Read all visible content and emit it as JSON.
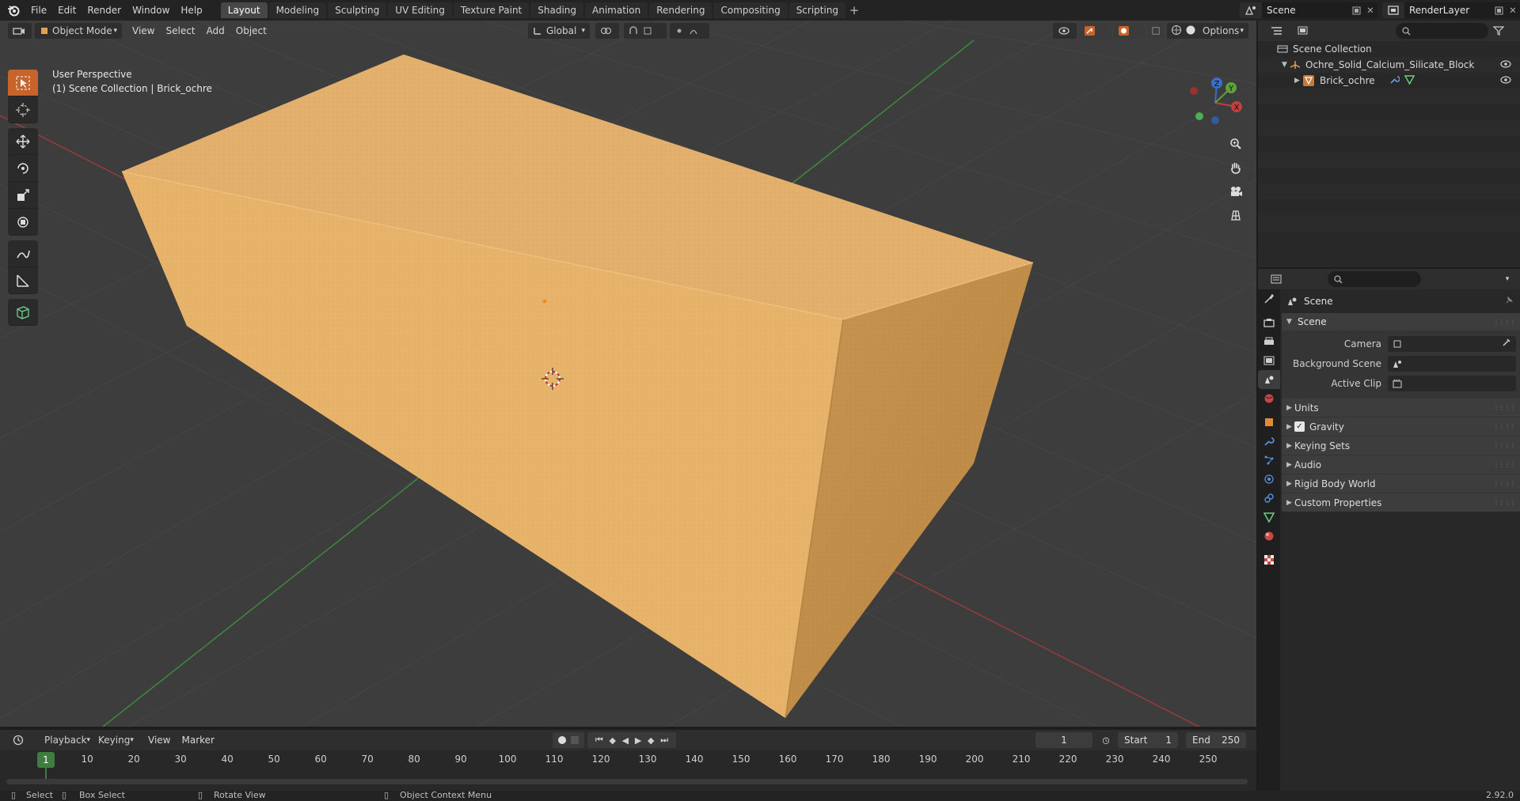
{
  "topbar": {
    "menus": [
      "File",
      "Edit",
      "Render",
      "Window",
      "Help"
    ],
    "workspaces": [
      "Layout",
      "Modeling",
      "Sculpting",
      "UV Editing",
      "Texture Paint",
      "Shading",
      "Animation",
      "Rendering",
      "Compositing",
      "Scripting"
    ],
    "active_workspace": "Layout",
    "scene_name": "Scene",
    "view_layer": "RenderLayer"
  },
  "viewport": {
    "mode": "Object Mode",
    "menus": [
      "View",
      "Select",
      "Add",
      "Object"
    ],
    "transform_orientation": "Global",
    "options_label": "Options",
    "info_line1": "User Perspective",
    "info_line2": "(1) Scene Collection | Brick_ochre",
    "gizmo_axes": {
      "x": "X",
      "y": "Y",
      "z": "Z"
    },
    "colors": {
      "background": "#3d3d3d",
      "x_axis": "#b03a3a",
      "y_axis": "#4c9b3a",
      "brick": "#e0ac63",
      "active_tool": "#c8642b"
    }
  },
  "timeline": {
    "playback": "Playback",
    "keying": "Keying",
    "menus": [
      "View",
      "Marker"
    ],
    "current_frame": "1",
    "start_label": "Start",
    "start": "1",
    "end_label": "End",
    "end": "250",
    "ruler_labels": [
      "1",
      "10",
      "20",
      "30",
      "40",
      "50",
      "60",
      "70",
      "80",
      "90",
      "100",
      "110",
      "120",
      "130",
      "140",
      "150",
      "160",
      "170",
      "180",
      "190",
      "200",
      "210",
      "220",
      "230",
      "240",
      "250"
    ]
  },
  "statusbar": {
    "select": "Select",
    "box_select": "Box Select",
    "rotate_view": "Rotate View",
    "context_menu": "Object Context Menu",
    "version": "2.92.0"
  },
  "outliner": {
    "root": "Scene Collection",
    "collection": "Ochre_Solid_Calcium_Silicate_Block",
    "object": "Brick_ochre"
  },
  "properties": {
    "breadcrumb": "Scene",
    "panel_title": "Scene",
    "fields": [
      {
        "label": "Camera",
        "value": ""
      },
      {
        "label": "Background Scene",
        "value": ""
      },
      {
        "label": "Active Clip",
        "value": ""
      }
    ],
    "subpanels": [
      "Units",
      "Gravity",
      "Keying Sets",
      "Audio",
      "Rigid Body World",
      "Custom Properties"
    ],
    "gravity_checked": true
  }
}
